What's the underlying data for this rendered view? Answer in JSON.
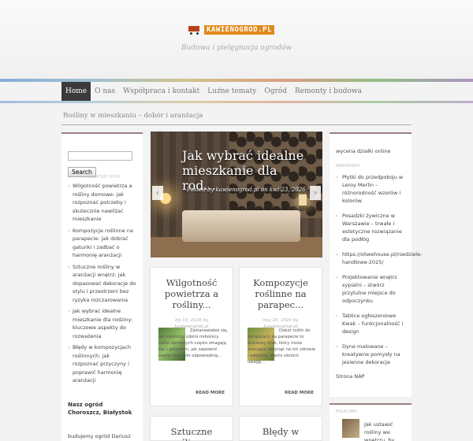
{
  "header": {
    "logo_text": "KAWIENOGROD.PL",
    "tagline": "Budowa i pielęgnacja ogrodów"
  },
  "nav": {
    "items": [
      "Home",
      "O nas",
      "Współpraca i kontakt",
      "Luźne tematy",
      "Ogród",
      "Remonty i budowa"
    ],
    "active": "Home"
  },
  "breadcrumb": "Rośliny w mieszkaniu – dobór i aranżacja",
  "left_sidebar": {
    "search_button": "Search",
    "ghost_label": "OSTATNIE WPISY",
    "posts": [
      "Wilgotność powietrza a rośliny domowe: jak rozpoznać potrzeby i skutecznie nawilżać mieszkanie",
      "Kompozycje roślinne na parapecie: jak dobrać gatunki i zadbać o harmonię aranżacji",
      "Sztuczne rośliny w aranżacji wnętrz: jak dopasować dekoracje do stylu i przestrzeni bez ryzyka rozczarowania",
      "Jak wybrać idealne mieszkanie dla rodziny: kluczowe aspekty do rozważenia",
      "Błędy w kompozycjach roślinnych: jak rozpoznać przyczyny i poprawić harmonię aranżacji"
    ],
    "heading": "Nasz ogród Choroszcz, Białystok",
    "extra": "budujemy ogród Dariusz Dworakowski"
  },
  "slider": {
    "title": "Jak wybrać idealne mieszkanie dla rod...",
    "meta": "Posted by kawienogrod.pl on kwi 23, 2026",
    "prev_icon": "‹",
    "next_icon": "›"
  },
  "posts": [
    {
      "title": "Wilgotność powietrza a rośliny...",
      "date": "lip 10, 2026 by",
      "author": "kawienogrod.pl",
      "excerpt": "Zastanawiałeś się, jak niektórzy zdolni miłośnicy roślin domowych często zmagają się z pytaniem, jak zapewnić swoim roślinom odpowiednią...",
      "more": "READ MORE"
    },
    {
      "title": "Kompozycje roślinne na parapec...",
      "date": "maj 20, 2026 by",
      "author": "kawienogrod.pl",
      "excerpt": "Dobór roślin do kompozycji na parapecie to kluczowy krok, który może znacząco wpłynąć na ich zdrowie i estetykę. Warto zwrócić uwagę...",
      "more": "READ MORE"
    },
    {
      "title": "Sztuczne rośliny w"
    },
    {
      "title": "Błędy w"
    }
  ],
  "right_sidebar": {
    "top": "wycena działki online",
    "head": "RENOWIENY",
    "items": [
      "Płytki do przedpokoju w Leroy Merlin – różnorodność wzorów i kolorów",
      "Posadzki żywiczne w Warszawie – trwałe i estetyczne rozwiązanie dla podłóg",
      "https://oliwehouse.pl/niedziele-handlowe-2025/",
      "Projektowanie wnętrz sypialni – stwórz przytulne miejsce do odpoczynku",
      "Tablice ogłoszeniowe Kwak – funkcjonalność i design",
      "Dyne malowane – kreatywne pomysły na jesienne dekoracje"
    ],
    "bottom": "Strona NAP"
  },
  "right_box2": {
    "head": "POLECAMY",
    "text": "Jak ustawić rośliny we wnętrzu, by"
  }
}
